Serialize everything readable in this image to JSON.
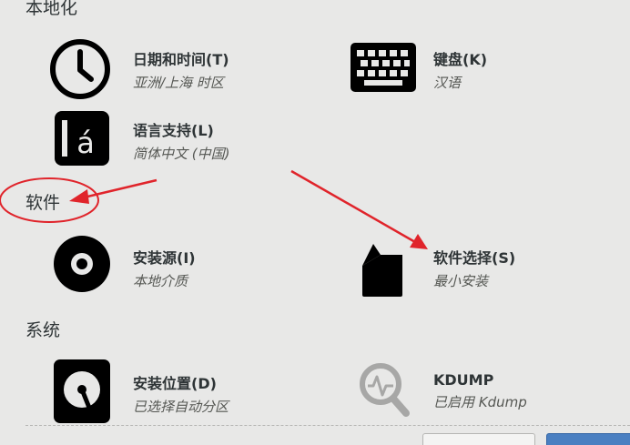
{
  "sections": {
    "localization": "本地化",
    "software": "软件",
    "system": "系统"
  },
  "spokes": {
    "datetime": {
      "title": "日期和时间(T)",
      "status": "亚洲/上海 时区",
      "icon": "clock-icon"
    },
    "keyboard": {
      "title": "键盘(K)",
      "status": "汉语",
      "icon": "keyboard-icon"
    },
    "language": {
      "title": "语言支持(L)",
      "status": "简体中文 (中国)",
      "icon": "language-icon"
    },
    "install_source": {
      "title": "安装源(I)",
      "status": "本地介质",
      "icon": "disc-icon"
    },
    "software_selection": {
      "title": "软件选择(S)",
      "status": "最小安装",
      "icon": "package-icon"
    },
    "install_destination": {
      "title": "安装位置(D)",
      "status": "已选择自动分区",
      "icon": "harddisk-icon"
    },
    "kdump": {
      "title": "KDUMP",
      "status": "已启用 Kdump",
      "icon": "kdump-magnifier-icon"
    }
  },
  "colors": {
    "background": "#e8e8e7",
    "annotation": "#e0242b",
    "icon": "#000000"
  }
}
